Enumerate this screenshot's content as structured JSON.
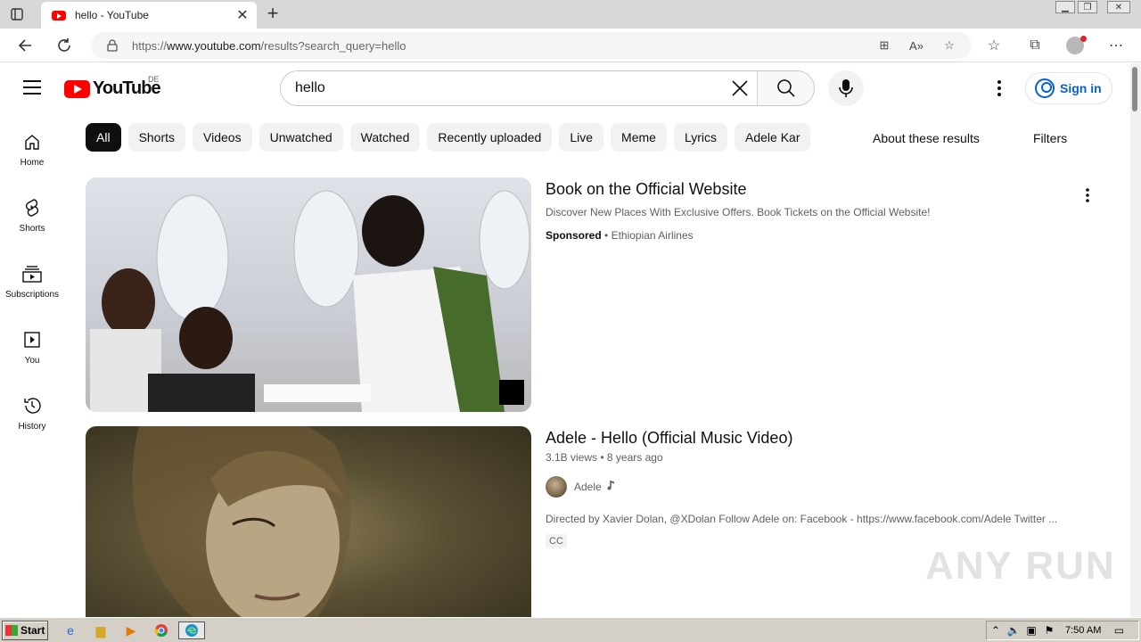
{
  "browser": {
    "tab_title": "hello - YouTube",
    "url_prefix": "https://",
    "url_host": "www.youtube.com",
    "url_path": "/results?search_query=hello"
  },
  "header": {
    "logo_text": "YouTube",
    "country_code": "DE",
    "search_value": "hello",
    "signin_label": "Sign in"
  },
  "sidebar": {
    "items": [
      {
        "label": "Home",
        "icon": "home-icon"
      },
      {
        "label": "Shorts",
        "icon": "shorts-icon"
      },
      {
        "label": "Subscriptions",
        "icon": "subscriptions-icon"
      },
      {
        "label": "You",
        "icon": "you-icon"
      },
      {
        "label": "History",
        "icon": "history-icon"
      }
    ]
  },
  "chips": [
    "All",
    "Shorts",
    "Videos",
    "Unwatched",
    "Watched",
    "Recently uploaded",
    "Live",
    "Meme",
    "Lyrics",
    "Adele Kar"
  ],
  "toolbar": {
    "about_label": "About these results",
    "filters_label": "Filters"
  },
  "results": [
    {
      "title": "Book on the Official Website",
      "description": "Discover New Places With Exclusive Offers. Book Tickets on the Official Website!",
      "sponsored_label": "Sponsored",
      "separator": "•",
      "advertiser": "Ethiopian Airlines"
    },
    {
      "title": "Adele - Hello (Official Music Video)",
      "views": "3.1B views",
      "separator": "•",
      "age": "8 years ago",
      "channel": "Adele",
      "description": "Directed by Xavier Dolan, @XDolan Follow Adele on: Facebook - https://www.facebook.com/Adele Twitter ...",
      "badge": "CC"
    }
  ],
  "watermark": "ANY RUN",
  "taskbar": {
    "start_label": "Start",
    "clock": "7:50 AM"
  },
  "colors": {
    "youtube_red": "#ff0000",
    "link_blue": "#065fd4",
    "chip_active": "#0f0f0f"
  }
}
